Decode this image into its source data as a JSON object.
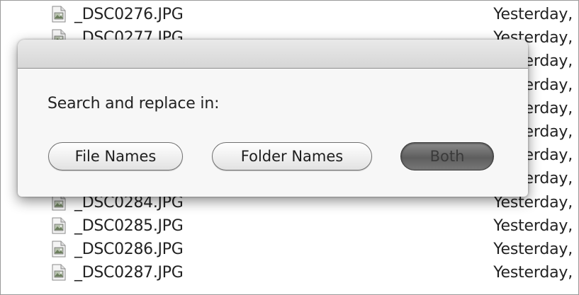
{
  "files": [
    {
      "name": "_DSC0276.JPG",
      "date": "Yesterday,"
    },
    {
      "name": "_DSC0277.JPG",
      "date": "Yesterday,"
    },
    {
      "name": "",
      "date": "Yesterday,"
    },
    {
      "name": "",
      "date": "Yesterday,"
    },
    {
      "name": "",
      "date": "Yesterday,"
    },
    {
      "name": "",
      "date": "Yesterday,"
    },
    {
      "name": "",
      "date": "Yesterday,"
    },
    {
      "name": "",
      "date": "Yesterday,"
    },
    {
      "name": "_DSC0284.JPG",
      "date": "Yesterday,"
    },
    {
      "name": "_DSC0285.JPG",
      "date": "Yesterday,"
    },
    {
      "name": "_DSC0286.JPG",
      "date": "Yesterday,"
    },
    {
      "name": "_DSC0287.JPG",
      "date": "Yesterday,"
    }
  ],
  "dialog": {
    "prompt": "Search and replace in:",
    "buttons": {
      "file_names": "File Names",
      "folder_names": "Folder Names",
      "both": "Both"
    },
    "selected": "both"
  },
  "icons": {
    "file": "image-file-icon"
  }
}
